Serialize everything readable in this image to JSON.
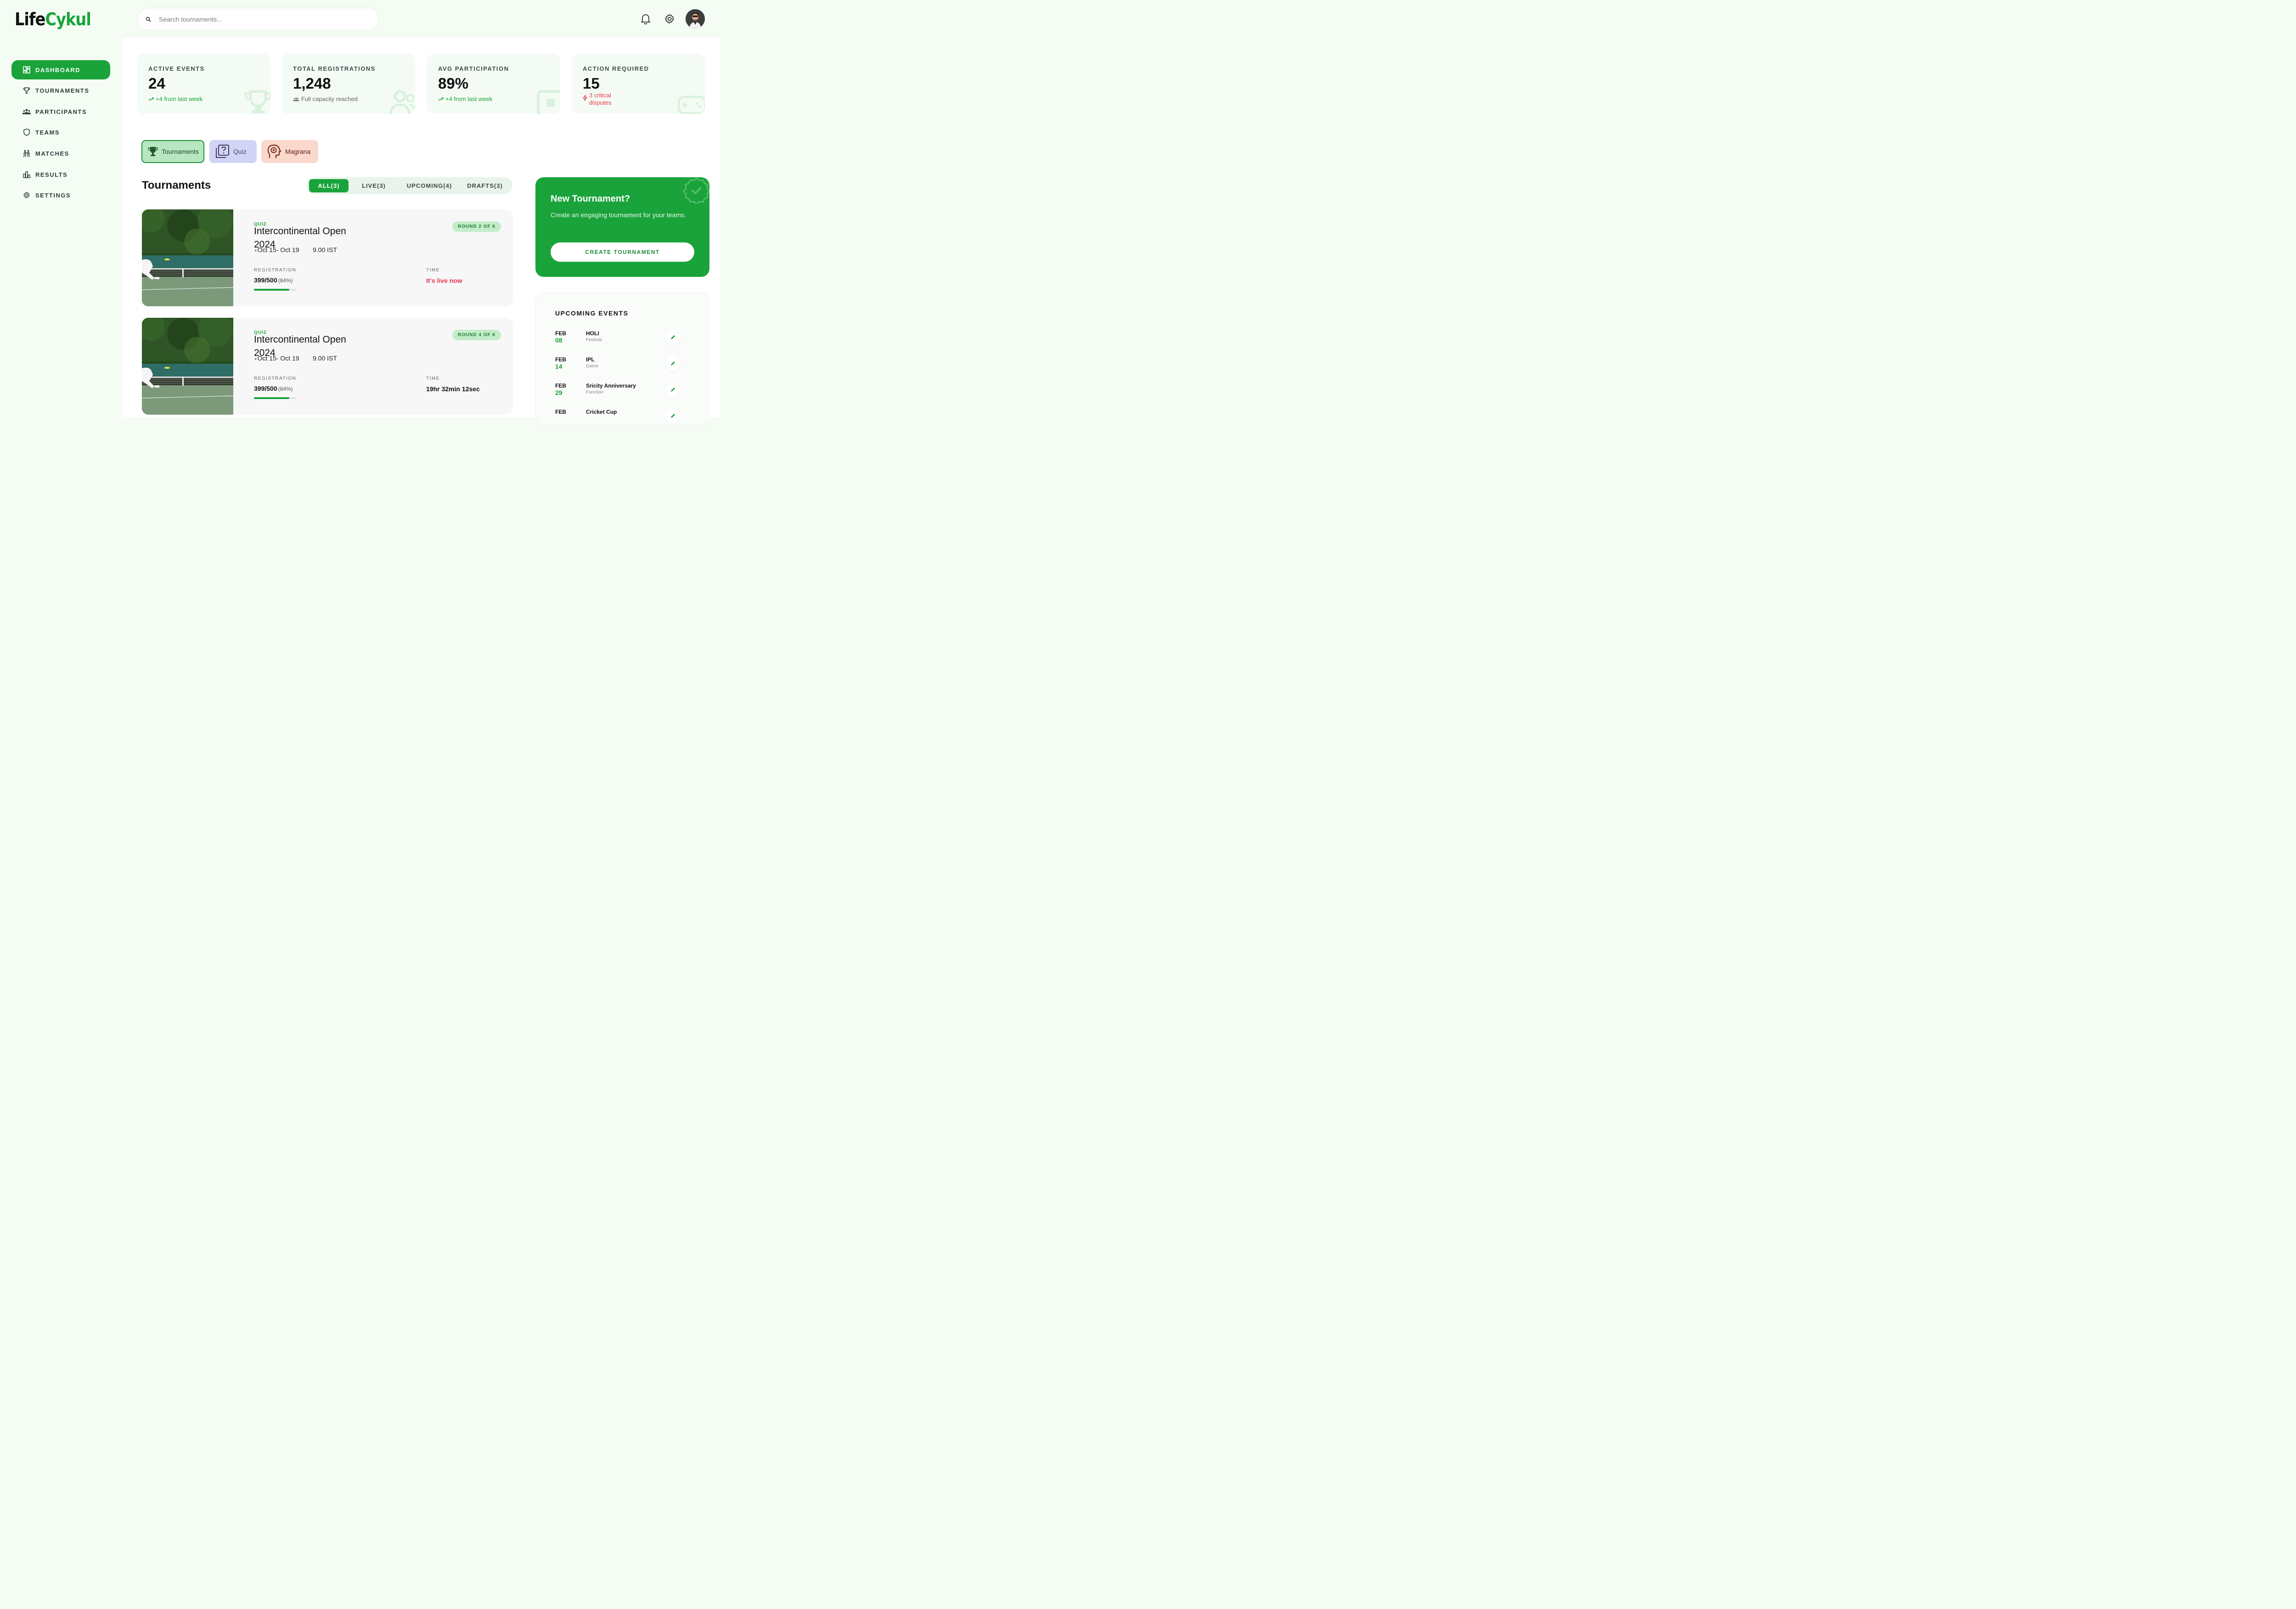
{
  "app": {
    "logo_part1": "Life",
    "logo_part2": "Cykul"
  },
  "search": {
    "placeholder": "Search tournaments..."
  },
  "topbar": {
    "icons": [
      "bell-icon",
      "gear-icon",
      "avatar"
    ]
  },
  "sidebar": {
    "items": [
      {
        "label": "DASHBOARD",
        "icon": "dashboard-icon",
        "active": true
      },
      {
        "label": "TOURNAMENTS",
        "icon": "trophy-icon",
        "active": false
      },
      {
        "label": "PARTICIPANTS",
        "icon": "people-icon",
        "active": false
      },
      {
        "label": "TEAMS",
        "icon": "shield-icon",
        "active": false
      },
      {
        "label": "MATCHES",
        "icon": "match-icon",
        "active": false
      },
      {
        "label": "RESULTS",
        "icon": "results-icon",
        "active": false
      },
      {
        "label": "SETTINGS",
        "icon": "settings-icon",
        "active": false
      }
    ]
  },
  "stats": [
    {
      "label": "ACTIVE EVENTS",
      "value": "24",
      "sub": "+4 from last week",
      "icon": "trend-up-icon"
    },
    {
      "label": "TOTAL REGISTRATIONS",
      "value": "1,248",
      "sub": "Full capacity reached",
      "icon": "people-icon"
    },
    {
      "label": "AVG PARTICIPATION",
      "value": "89%",
      "sub": "+4 from last week",
      "icon": "trend-up-icon"
    },
    {
      "label": "ACTION REQUIRED",
      "value": "15",
      "sub_line1": "3 critical",
      "sub_line2": "disputes",
      "icon": "bolt-icon"
    }
  ],
  "categories": [
    {
      "label": "Tournaments",
      "icon": "trophy-icon"
    },
    {
      "label": "Quiz",
      "icon": "quiz-icon"
    },
    {
      "label": "Magrana",
      "icon": "head-icon"
    }
  ],
  "section": {
    "title": "Tournaments"
  },
  "filters": [
    {
      "label": "ALL(3)",
      "active": true
    },
    {
      "label": "LIVE(3)",
      "active": false
    },
    {
      "label": "UPCOMING(4)",
      "active": false
    },
    {
      "label": "DRAFTS(3)",
      "active": false
    }
  ],
  "tournaments": [
    {
      "kind": "QUIZ",
      "name_line1": "Intercontinental Open",
      "name_line2": "2024",
      "dates": "Oct 15- Oct 19",
      "time": "9.00 IST",
      "round": "ROUND 2 OF 6",
      "reg_label": "REGISTRATION",
      "reg_value": "399/500",
      "reg_pct": "(84%)",
      "reg_fraction": 0.84,
      "time_label": "TIME",
      "time_value": "It's live now",
      "time_color": "#e8384f"
    },
    {
      "kind": "QUIZ",
      "name_line1": "Intercontinental Open",
      "name_line2": "2024",
      "dates": "Oct 15- Oct 19",
      "time": "9.00 IST",
      "round": "ROUND 4 OF 6",
      "reg_label": "REGISTRATION",
      "reg_value": "399/500",
      "reg_pct": "(84%)",
      "reg_fraction": 0.84,
      "time_label": "TIME",
      "time_value": "19hr 32min 12sec",
      "time_color": "#111111"
    }
  ],
  "new_tournament": {
    "title": "New Tournament?",
    "desc": "Create an engaging tournament for your teams.",
    "button": "CREATE TOURNAMENT"
  },
  "upcoming": {
    "title": "UPCOMING EVENTS",
    "events": [
      {
        "month": "FEB",
        "day": "08",
        "name": "HOLI",
        "type": "Festival"
      },
      {
        "month": "FEB",
        "day": "14",
        "name": "IPL",
        "type": "Game"
      },
      {
        "month": "FEB",
        "day": "29",
        "name": "Sricity Anniversary",
        "type": "Function"
      },
      {
        "month": "FEB",
        "day": "",
        "name": "Cricket Cup",
        "type": ""
      }
    ]
  },
  "colors": {
    "brand": "#1aa33a",
    "live": "#e8384f",
    "background": "#f4fcf4"
  }
}
